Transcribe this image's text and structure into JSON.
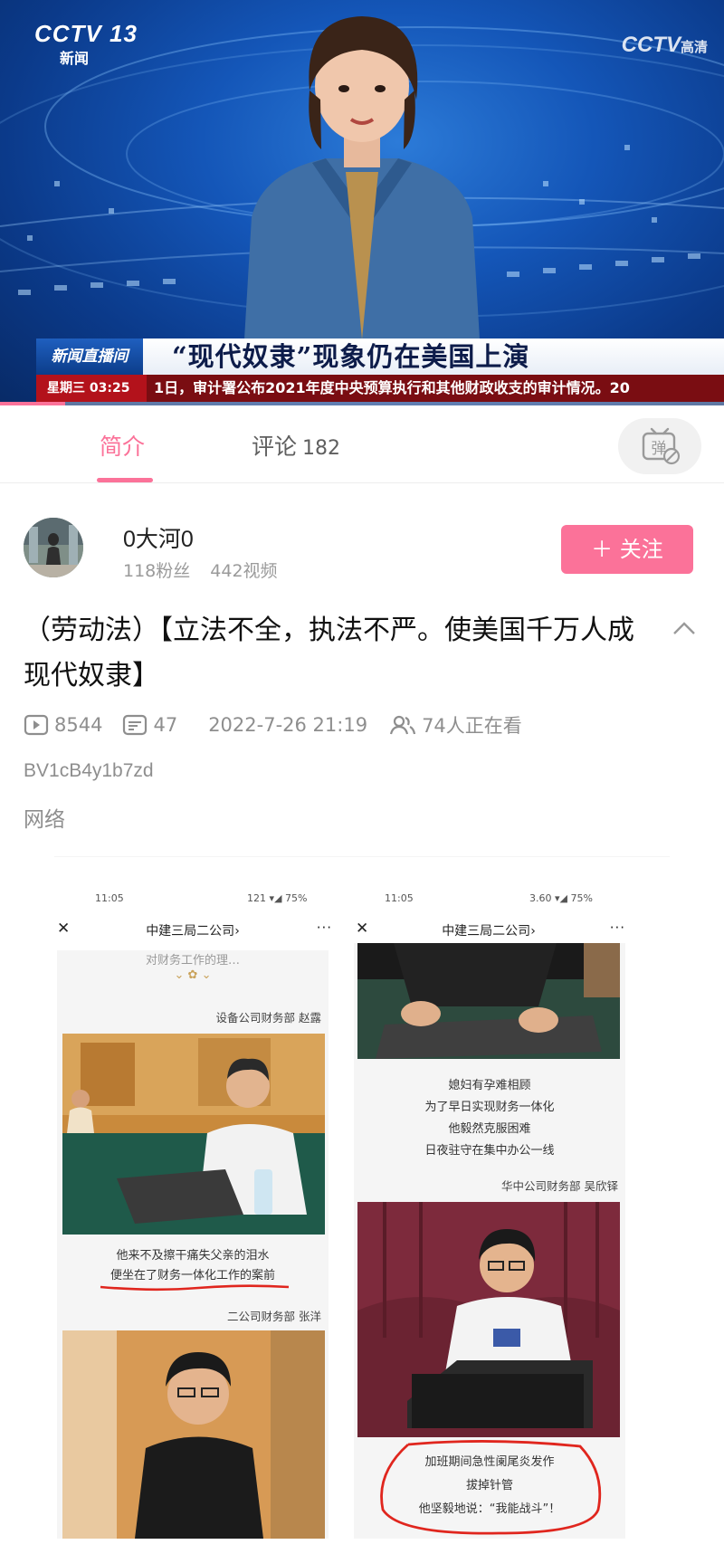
{
  "video": {
    "channel_logo": "CCTV 13",
    "channel_sub": "新闻",
    "watermark": "CCTV",
    "watermark_sub": "高清",
    "program_tag": "新闻直播间",
    "headline": "“现代奴隶”现象仍在美国上演",
    "ticker_day": "星期三",
    "ticker_time": "03:25",
    "ticker_text": "1日，审计署公布2021年度中央预算执行和其他财政收支的审计情况。20",
    "progress": 0.09
  },
  "tabs": {
    "intro": "简介",
    "comments": "评论",
    "comments_count": "182",
    "danmaku_icon": "danmaku-off-icon",
    "danmaku_char": "弹"
  },
  "uploader": {
    "name": "0大河0",
    "fans": "118粉丝",
    "videos": "442视频",
    "follow_label": "＋ 关注"
  },
  "info": {
    "title": "（劳动法）【立法不全，执法不严。使美国千万人成现代奴隶】",
    "plays": "8544",
    "danmaku": "47",
    "date": "2022-7-26 21:19",
    "watching": "74人正在看",
    "bvid": "BV1cB4y1b7zd",
    "category": "网络"
  },
  "collage": {
    "left": {
      "time": "11:05",
      "status": "121 ▾◢ 75%",
      "header": "中建三局二公司",
      "top_clip": "对财务工作的理…",
      "byline1": "设备公司财务部 赵露",
      "caption1": "他来不及擦干痛失父亲的泪水",
      "caption2": "便坐在了财务一体化工作的案前",
      "byline2": "二公司财务部 张洋"
    },
    "right": {
      "time": "11:05",
      "status": "3.60 ▾◢ 75%",
      "header": "中建三局二公司",
      "cap1": "媳妇有孕难相顾",
      "cap2": "为了早日实现财务一体化",
      "cap3": "他毅然克服困难",
      "cap4": "日夜驻守在集中办公一线",
      "byline": "华中公司财务部 吴欣铎",
      "bottom1": "加班期间急性阑尾炎发作",
      "bottom2": "拔掉针管",
      "bottom3": "他坚毅地说：“我能战斗”！"
    }
  },
  "colors": {
    "accent": "#fb7299",
    "muted": "#8e8e8e",
    "ticker_red": "#b3121b",
    "news_blue": "#1456b8"
  }
}
